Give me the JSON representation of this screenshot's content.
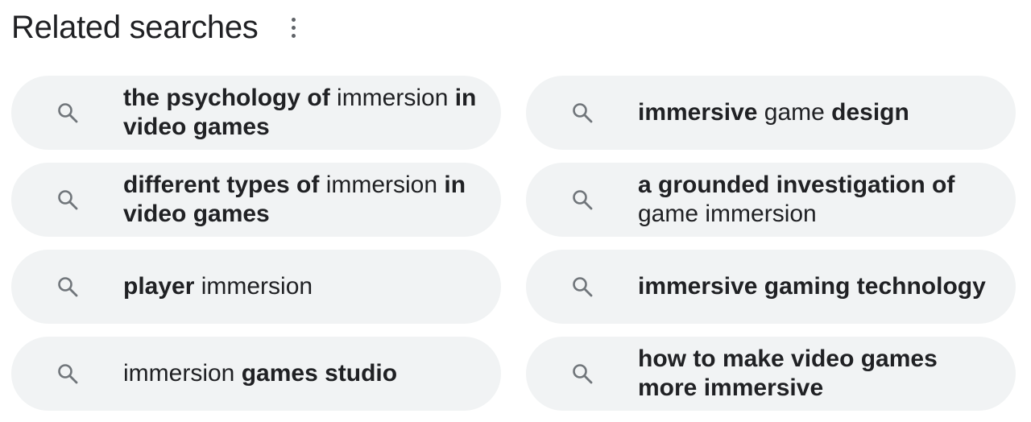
{
  "header": {
    "title": "Related searches",
    "more_icon": "more-vert-icon"
  },
  "search_icon": "search-icon",
  "suggestions": [
    {
      "parts": [
        {
          "t": "the psychology of",
          "b": true
        },
        {
          "t": " immersion ",
          "b": false
        },
        {
          "t": "in video games",
          "b": true
        }
      ]
    },
    {
      "parts": [
        {
          "t": "immersive",
          "b": true
        },
        {
          "t": " game ",
          "b": false
        },
        {
          "t": "design",
          "b": true
        }
      ]
    },
    {
      "parts": [
        {
          "t": "different types of",
          "b": true
        },
        {
          "t": " immersion ",
          "b": false
        },
        {
          "t": "in video games",
          "b": true
        }
      ]
    },
    {
      "parts": [
        {
          "t": "a grounded investigation of",
          "b": true
        },
        {
          "t": " game immersion",
          "b": false
        }
      ]
    },
    {
      "parts": [
        {
          "t": "player",
          "b": true
        },
        {
          "t": " immersion",
          "b": false
        }
      ]
    },
    {
      "parts": [
        {
          "t": "immersive gaming technology",
          "b": true
        }
      ]
    },
    {
      "parts": [
        {
          "t": "immersion ",
          "b": false
        },
        {
          "t": "games studio",
          "b": true
        }
      ]
    },
    {
      "parts": [
        {
          "t": "how to make video games more immersive",
          "b": true
        }
      ]
    }
  ]
}
